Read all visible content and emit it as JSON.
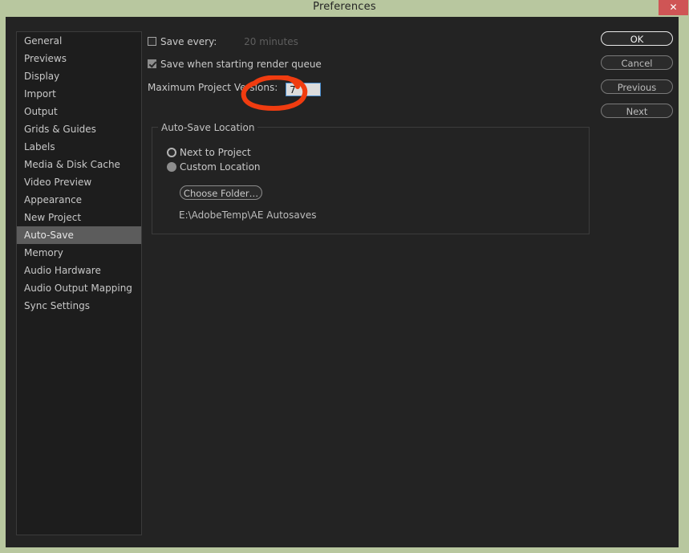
{
  "window": {
    "title": "Preferences",
    "close_label": "✕",
    "accent_close_color": "#cf5555",
    "titlebar_color": "#b8c79f",
    "body_color": "#232323"
  },
  "sidebar": {
    "items": [
      {
        "label": "General",
        "selected": false
      },
      {
        "label": "Previews",
        "selected": false
      },
      {
        "label": "Display",
        "selected": false
      },
      {
        "label": "Import",
        "selected": false
      },
      {
        "label": "Output",
        "selected": false
      },
      {
        "label": "Grids & Guides",
        "selected": false
      },
      {
        "label": "Labels",
        "selected": false
      },
      {
        "label": "Media & Disk Cache",
        "selected": false
      },
      {
        "label": "Video Preview",
        "selected": false
      },
      {
        "label": "Appearance",
        "selected": false
      },
      {
        "label": "New Project",
        "selected": false
      },
      {
        "label": "Auto-Save",
        "selected": true
      },
      {
        "label": "Memory",
        "selected": false
      },
      {
        "label": "Audio Hardware",
        "selected": false
      },
      {
        "label": "Audio Output Mapping",
        "selected": false
      },
      {
        "label": "Sync Settings",
        "selected": false
      }
    ],
    "selected_label": "Auto-Save",
    "selected_color": "#5c5c5c"
  },
  "main": {
    "save_every": {
      "label": "Save every:",
      "checked": false,
      "value": "20 minutes",
      "value_disabled": true
    },
    "save_render_queue": {
      "label": "Save when starting render queue",
      "checked": true
    },
    "max_versions": {
      "label": "Maximum Project Versions:",
      "value": "7",
      "field_border_color": "#4b8fd0"
    },
    "group": {
      "title": "Auto-Save Location",
      "radios": [
        {
          "label": "Next to Project",
          "selected": false
        },
        {
          "label": "Custom Location",
          "selected": true
        }
      ],
      "choose_folder_label": "Choose Folder…",
      "path": "E:\\AdobeTemp\\AE Autosaves"
    }
  },
  "buttons": [
    {
      "label": "OK",
      "primary": true
    },
    {
      "label": "Cancel",
      "primary": false
    },
    {
      "label": "Previous",
      "primary": false
    },
    {
      "label": "Next",
      "primary": false
    }
  ],
  "annotation": {
    "shape": "hand-drawn-circle",
    "color": "#f03c10",
    "target": "Maximum Project Versions field"
  }
}
